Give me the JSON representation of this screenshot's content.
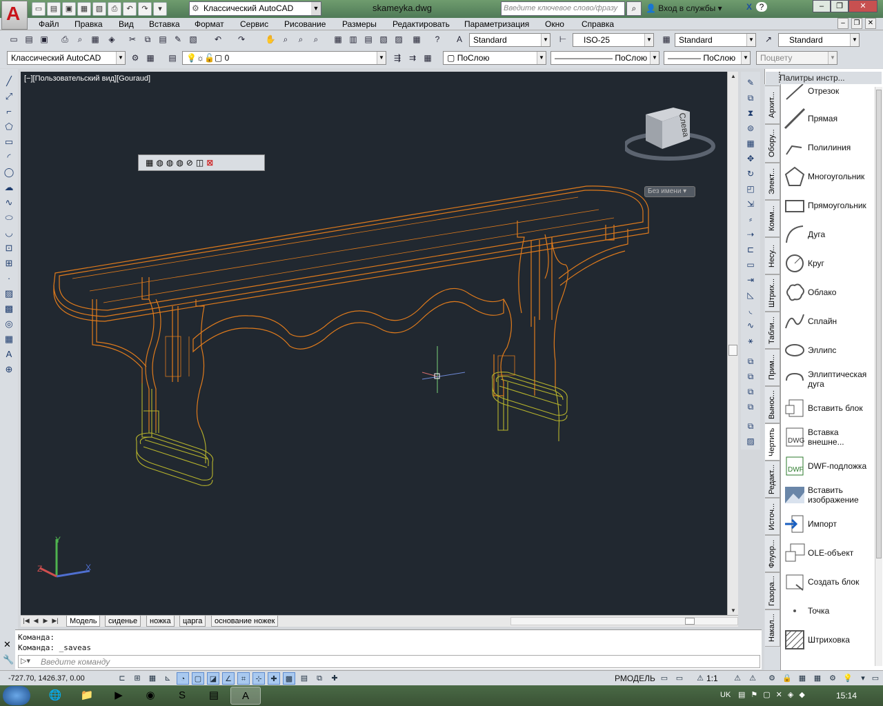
{
  "title_bar": {
    "workspace": "Классический AutoCAD",
    "document": "skameyka.dwg",
    "search_placeholder": "Введите ключевое слово/фразу",
    "login": "Вход в службы"
  },
  "menu": [
    "Файл",
    "Правка",
    "Вид",
    "Вставка",
    "Формат",
    "Сервис",
    "Рисование",
    "Размеры",
    "Редактировать",
    "Параметризация",
    "Окно",
    "Справка"
  ],
  "styles_toolbar": {
    "text_style": "Standard",
    "dim_style": "ISO-25",
    "table_style": "Standard",
    "multileader_style": "Standard"
  },
  "workspace_toolbar": {
    "workspace": "Классический AutoCAD",
    "layer": "0"
  },
  "properties_toolbar": {
    "color": "ПоСлою",
    "linetype": "ПоСлою",
    "lineweight": "ПоСлою",
    "plot_style": "Поцвету"
  },
  "viewport": {
    "label": "[−][Пользовательский вид][Gouraud]",
    "viewcube_face": "Слева",
    "ucs_menu": "Без имени",
    "ucs_axes": [
      "Y",
      "Z",
      "X"
    ]
  },
  "layout_tabs": [
    "Модель",
    "сиденье",
    "ножка",
    "царга",
    "основание ножек"
  ],
  "palette": {
    "title": "Палитры инстр...",
    "tabs": [
      "Архит...",
      "Обору...",
      "Элект...",
      "Комм...",
      "Несу...",
      "Штрих...",
      "Табли...",
      "Прим...",
      "Вынос...",
      "Чертить",
      "Редакт...",
      "Источ...",
      "Флуор...",
      "Газора...",
      "Накал..."
    ],
    "active_tab": "Чертить",
    "items": [
      "Отрезок",
      "Прямая",
      "Полилиния",
      "Многоугольник",
      "Прямоугольник",
      "Дуга",
      "Круг",
      "Облако",
      "Сплайн",
      "Эллипс",
      "Эллиптическая дуга",
      "Вставить блок",
      "Вставка внешне...",
      "DWF-подложка",
      "Вставить изображение",
      "Импорт",
      "OLE-объект",
      "Создать блок",
      "Точка",
      "Штриховка"
    ]
  },
  "command": {
    "line1": "Команда:",
    "line2": "Команда: _saveas",
    "placeholder": "Введите команду"
  },
  "status": {
    "coordinates": "-727.70, 1426.37, 0.00",
    "space": "РМОДЕЛЬ",
    "scale": "1:1"
  },
  "taskbar": {
    "language": "UK",
    "time": "15:14"
  },
  "colors": {
    "viewport_bg": "#212830",
    "model_orange": "#e07b1c",
    "model_yellow": "#b8b52c"
  }
}
